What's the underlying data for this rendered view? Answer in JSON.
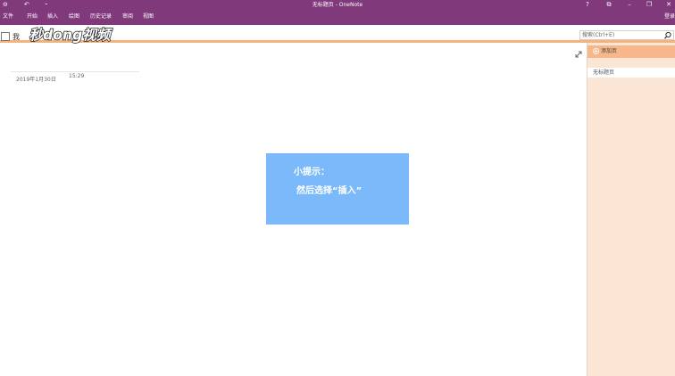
{
  "window": {
    "title": "无标题页 - OneNote",
    "controls": {
      "help": "?",
      "ribbon_display": "⧉",
      "minimize": "–",
      "restore": "❐",
      "close": "✕"
    },
    "quick_access": {
      "back": "⊖",
      "undo": "↶",
      "more": "⁃"
    }
  },
  "ribbon": {
    "tabs": [
      "文件",
      "开始",
      "插入",
      "绘图",
      "历史记录",
      "审阅",
      "视图"
    ],
    "login": "登录"
  },
  "notebook": {
    "label": "我",
    "watermark": "秒dong视频"
  },
  "search": {
    "placeholder": "搜索(Ctrl+E)"
  },
  "page": {
    "date": "2019年1月30日",
    "time": "15:29"
  },
  "tip": {
    "line1": "小提示：",
    "line2": "然后选择“插入”",
    "color": "#7bb9fb"
  },
  "pages_pane": {
    "add_page_label": "添加页",
    "items": [
      {
        "label": "无标题页"
      }
    ]
  },
  "colors": {
    "accent": "#80397b",
    "pane": "#fbe6d5",
    "add_page": "#f7b78a"
  }
}
